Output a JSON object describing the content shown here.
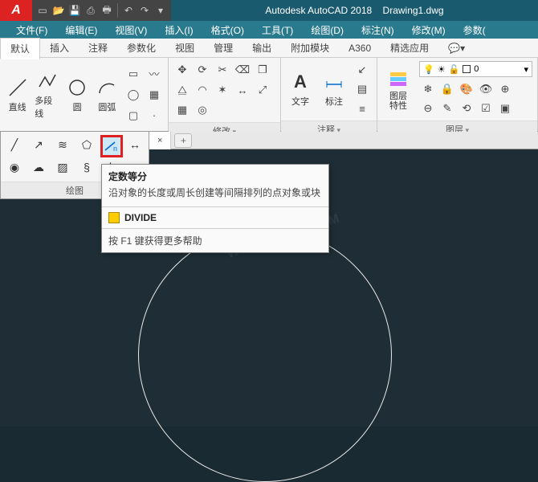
{
  "title": {
    "app": "Autodesk AutoCAD 2018",
    "doc": "Drawing1.dwg"
  },
  "menus": [
    "文件(F)",
    "编辑(E)",
    "视图(V)",
    "插入(I)",
    "格式(O)",
    "工具(T)",
    "绘图(D)",
    "标注(N)",
    "修改(M)",
    "参数("
  ],
  "tabs": {
    "items": [
      "默认",
      "插入",
      "注释",
      "参数化",
      "视图",
      "管理",
      "输出",
      "附加模块",
      "A360",
      "精选应用"
    ],
    "active": 0
  },
  "qat_icons": [
    "new",
    "open",
    "save",
    "saveas",
    "print",
    "undo",
    "redo"
  ],
  "panels": {
    "draw": {
      "title": "绘图",
      "line": "直线",
      "pline": "多段线",
      "circle": "圆",
      "arc": "圆弧"
    },
    "modify": {
      "title": "修改"
    },
    "annotate": {
      "title": "注释",
      "text": "文字",
      "dim": "标注"
    },
    "layer": {
      "title": "图层",
      "props": "图层\n特性",
      "current": "0"
    }
  },
  "drop_panel_title": "绘图",
  "file_tab_close": "×",
  "new_tab": "+",
  "tooltip": {
    "title": "定数等分",
    "desc": "沿对象的长度或周长创建等间隔排列的点对象或块",
    "cmd": "DIVIDE",
    "help": "按 F1 键获得更多帮助"
  },
  "watermark": {
    "a": "软件自学网",
    "b": "WWW.RJZXW.COM"
  }
}
